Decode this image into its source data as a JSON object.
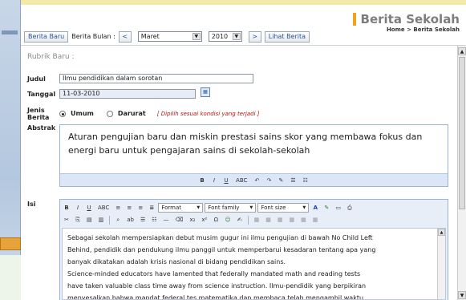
{
  "header": {
    "title": "Berita Sekolah",
    "breadcrumb": "Home > Berita Sekolah"
  },
  "nav": {
    "berita_baru": "Berita Baru",
    "berita_bulan_label": "Berita Bulan :",
    "prev": "<",
    "month": "Maret",
    "year": "2010",
    "next": ">",
    "lihat_berita": "Lihat Berita"
  },
  "form": {
    "section_title": "Rubrik Baru :",
    "judul_label": "Judul",
    "judul_value": "Ilmu pendidikan dalam sorotan",
    "tanggal_label": "Tanggal",
    "tanggal_value": "11-03-2010",
    "jenis_label_1": "Jenis",
    "jenis_label_2": "Berita",
    "jenis_options": [
      "Umum",
      "Darurat"
    ],
    "jenis_selected": "Umum",
    "jenis_hint": "[ Dipilih sesuai kondisi yang terjadi ]",
    "abstrak_label": "Abstrak",
    "abstrak_text": "Aturan pengujian baru dan miskin prestasi sains skor yang membawa fokus dan energi baru untuk pengajaran sains di sekolah-sekolah",
    "isi_label": "Isi",
    "isi_lines": [
      "Sebagai sekolah mempersiapkan debut musim gugur ini ilmu pengujian di bawah No Child Left",
      "Behind, pendidik dan pendukung ilmu panggil untuk memperbarui kesadaran tentang apa yang",
      "banyak dikatakan adalah krisis nasional di bidang pendidikan sains.",
      "Science-minded educators have lamented that federally mandated math and reading tests",
      "have taken valuable class time away from science instruction. Ilmu-pendidik yang berpikiran",
      "menyesalkan bahwa mandat federal tes matematika dan membaca telah mengambil waktu"
    ]
  },
  "editor": {
    "format_label": "Format",
    "font_family_label": "Font family",
    "font_size_label": "Font size"
  },
  "colors": {
    "accent": "#f1a21b",
    "link": "#28539c",
    "hint": "#c01010",
    "toolbar_bg": "#dbe7f7"
  }
}
